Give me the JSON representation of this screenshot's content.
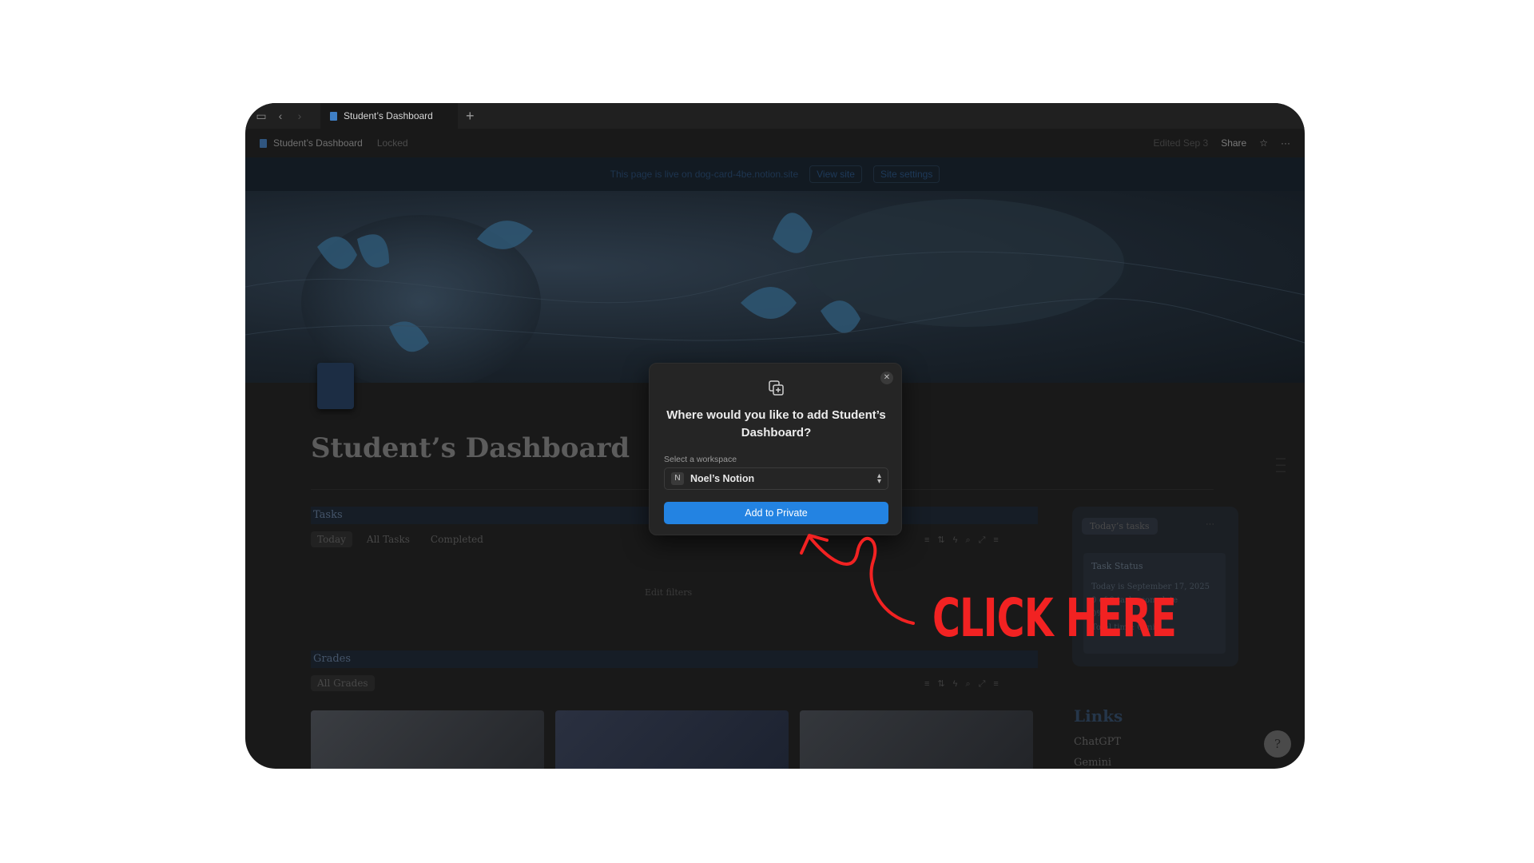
{
  "tabbar": {
    "tab_title": "Student’s Dashboard",
    "new_tab": "+"
  },
  "topbar": {
    "breadcrumb": "Student’s Dashboard",
    "locked": "Locked",
    "edited": "Edited Sep 3",
    "share": "Share"
  },
  "banner": {
    "text": "This page is live on dog-card-4be.notion.site",
    "view_site": "View site",
    "site_settings": "Site settings"
  },
  "page": {
    "title": "Student’s Dashboard"
  },
  "tasks": {
    "heading": "Tasks",
    "views": [
      "Today",
      "All Tasks",
      "Completed"
    ],
    "edit_filters": "Edit filters"
  },
  "grades": {
    "heading": "Grades",
    "views": [
      "All Grades"
    ]
  },
  "sidebar": {
    "todays_tasks": "Today’s tasks",
    "task_status": "Task Status",
    "date_line": "Today is September 17, 2025",
    "complete_line": "0 of 0 tasks complete",
    "percent": "0%",
    "total_time": "Total time: 0 min"
  },
  "links": {
    "heading": "Links",
    "items": [
      "ChatGPT",
      "Gemini"
    ]
  },
  "modal": {
    "question": "Where would you like to add Student’s Dashboard?",
    "select_label": "Select a workspace",
    "workspace_initial": "N",
    "workspace_name": "Noel’s Notion",
    "button": "Add to Private"
  },
  "annotation": {
    "text": "CLICK HERE",
    "color": "#f22222"
  },
  "colors": {
    "accent": "#2383e2",
    "background": "#191919"
  }
}
